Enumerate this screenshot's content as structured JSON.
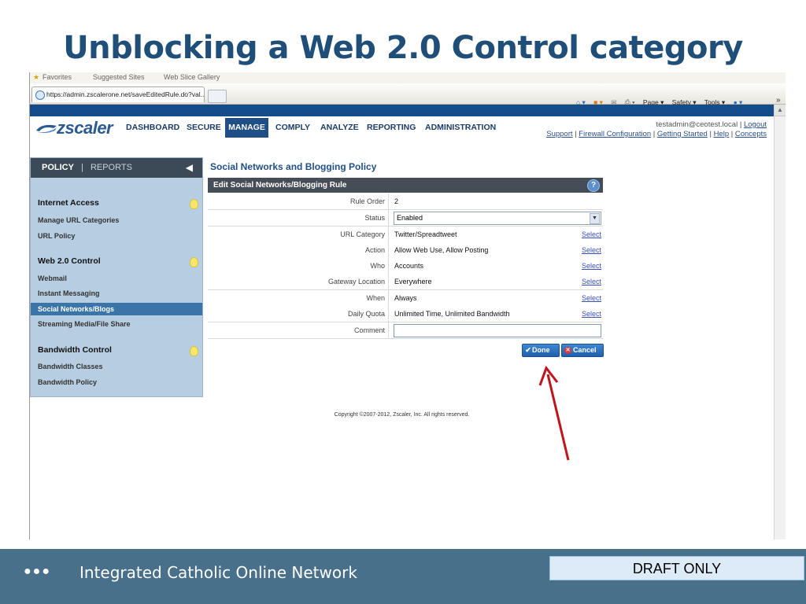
{
  "slide": {
    "title": "Unblocking a Web 2.0 Control category",
    "footer_text": "Integrated Catholic Online Network",
    "draft_label": "DRAFT ONLY"
  },
  "browser": {
    "favorites_bar": [
      "Favorites",
      "Suggested Sites",
      "Web Slice Gallery"
    ],
    "tab_url": "https://admin.zscalerone.net/saveEditedRule.do?val...",
    "toolbar": [
      "Page ▾",
      "Safety ▾",
      "Tools ▾"
    ]
  },
  "app": {
    "logo": "zscaler",
    "nav": [
      "DASHBOARD",
      "SECURE",
      "MANAGE",
      "COMPLY",
      "ANALYZE",
      "REPORTING",
      "ADMINISTRATION"
    ],
    "active_nav": "MANAGE",
    "user": "testadmin@ceotest.local",
    "logout": "Logout",
    "links": [
      "Support",
      "Firewall Configuration",
      "Getting Started",
      "Help",
      "Concepts"
    ],
    "accent_color": "#1f4f86"
  },
  "sidebar": {
    "tab_policy": "POLICY",
    "tab_sep": "|",
    "tab_reports": "REPORTS",
    "sections": [
      {
        "title": "Internet Access",
        "items": [
          "Manage URL Categories",
          "URL Policy"
        ]
      },
      {
        "title": "Web 2.0 Control",
        "items": [
          "Webmail",
          "Instant Messaging",
          "Social Networks/Blogs",
          "Streaming Media/File Share"
        ]
      },
      {
        "title": "Bandwidth Control",
        "items": [
          "Bandwidth Classes",
          "Bandwidth Policy"
        ]
      }
    ],
    "active_item": "Social Networks/Blogs"
  },
  "form": {
    "page_title": "Social Networks and Blogging Policy",
    "header": "Edit Social Networks/Blogging Rule",
    "select_label": "Select",
    "rows": [
      {
        "label": "Rule Order",
        "value": "2"
      },
      {
        "label": "Status",
        "value": "Enabled"
      },
      {
        "label": "URL Category",
        "value": "Twitter/Spreadtweet"
      },
      {
        "label": "Action",
        "value": "Allow Web Use, Allow Posting"
      },
      {
        "label": "Who",
        "value": "Accounts"
      },
      {
        "label": "Gateway Location",
        "value": "Everywhere"
      },
      {
        "label": "When",
        "value": "Always"
      },
      {
        "label": "Daily Quota",
        "value": "Unlimited Time, Unlimited Bandwidth"
      },
      {
        "label": "Comment",
        "value": ""
      }
    ],
    "done_label": "Done",
    "cancel_label": "Cancel"
  },
  "copyright": "Copyright ©2007-2012, Zscaler, Inc. All rights reserved."
}
